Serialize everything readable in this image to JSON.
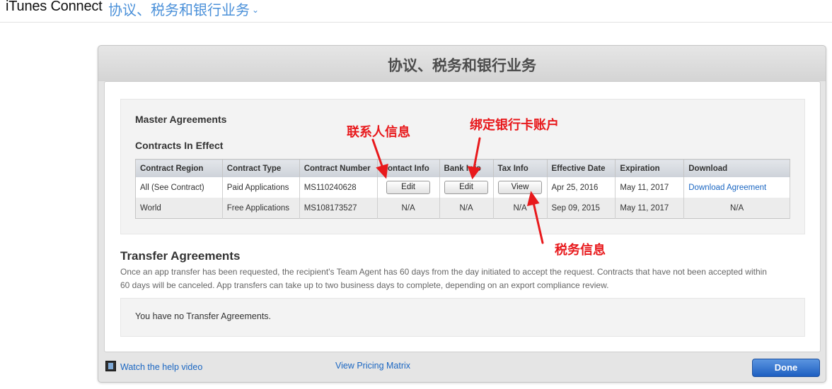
{
  "header": {
    "app_title": "iTunes Connect",
    "section_menu": "协议、税务和银行业务"
  },
  "window": {
    "title": "协议、税务和银行业务"
  },
  "master": {
    "title": "Master Agreements",
    "contracts_title": "Contracts In Effect",
    "columns": [
      "Contract Region",
      "Contract Type",
      "Contract Number",
      "Contact Info",
      "Bank Info",
      "Tax Info",
      "Effective Date",
      "Expiration",
      "Download"
    ],
    "rows": [
      {
        "region": "All (See Contract)",
        "type": "Paid Applications",
        "number": "MS110240628",
        "contact": "Edit",
        "bank": "Edit",
        "tax": "View",
        "effective": "Apr 25, 2016",
        "expiration": "May 11, 2017",
        "download": "Download Agreement"
      },
      {
        "region": "World",
        "type": "Free Applications",
        "number": "MS108173527",
        "contact": "N/A",
        "bank": "N/A",
        "tax": "N/A",
        "effective": "Sep 09, 2015",
        "expiration": "May 11, 2017",
        "download": "N/A"
      }
    ]
  },
  "transfer": {
    "title": "Transfer Agreements",
    "description": "Once an app transfer has been requested, the recipient's Team Agent has 60 days from the day initiated to accept the request. Contracts that have not been accepted within 60 days will be canceled. App transfers can take up to two business days to complete, depending on an export compliance review.",
    "empty_message": "You have no Transfer Agreements."
  },
  "footer": {
    "help_video": "Watch the help video",
    "pricing_matrix": "View Pricing Matrix",
    "done": "Done"
  },
  "annotations": {
    "contact": "联系人信息",
    "bank": "绑定银行卡账户",
    "tax": "税务信息"
  },
  "colors": {
    "link": "#1a66c2",
    "annotation": "#e8191c",
    "done_button": "#1e5fc1"
  },
  "icons": {
    "section_menu": "chevron-down-icon",
    "help_video": "film-icon"
  }
}
